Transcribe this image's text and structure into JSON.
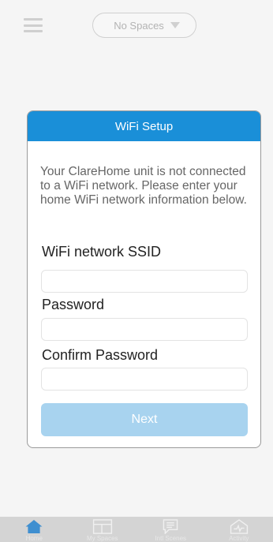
{
  "header": {
    "spaces_selector": "No Spaces"
  },
  "dialog": {
    "title": "WiFi Setup",
    "message": "Your ClareHome unit is not connected to a WiFi network. Please enter your home WiFi network information below.",
    "ssid_label": "WiFi network SSID",
    "ssid_value": "",
    "password_label": "Password",
    "password_value": "",
    "confirm_label": "Confirm Password",
    "confirm_value": "",
    "next_label": "Next"
  },
  "tabbar": {
    "tabs": [
      {
        "label": "Home",
        "icon": "home-icon"
      },
      {
        "label": "My Spaces",
        "icon": "spaces-icon"
      },
      {
        "label": "Intl Scenes",
        "icon": "scenes-icon"
      },
      {
        "label": "Activity",
        "icon": "activity-icon"
      }
    ]
  },
  "colors": {
    "accent": "#1a8fd8",
    "button_disabled": "#a8d3ef",
    "tabbar": "#d4d4d4"
  }
}
